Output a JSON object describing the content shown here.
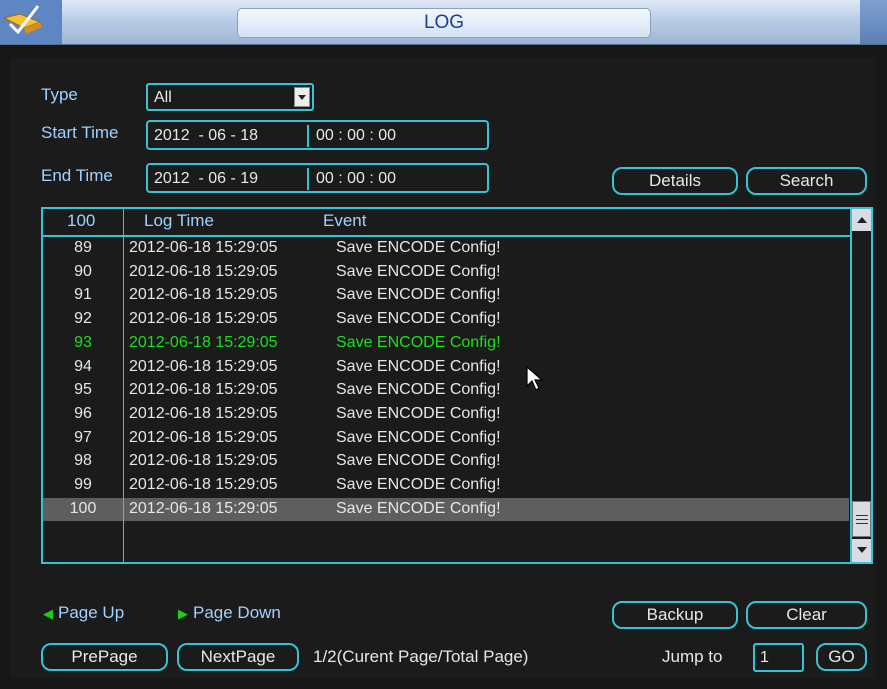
{
  "window": {
    "title": "LOG"
  },
  "filters": {
    "type_label": "Type",
    "type_value": "All",
    "start_label": "Start Time",
    "start_date": "2012  - 06 - 18",
    "start_time": "00 : 00 : 00",
    "end_label": "End Time",
    "end_date": "2012  - 06 - 19",
    "end_time": "00 : 00 : 00",
    "details_label": "Details",
    "search_label": "Search"
  },
  "table": {
    "headers": {
      "no": "100",
      "time": "Log Time",
      "event": "Event"
    },
    "rows": [
      {
        "no": "89",
        "time": "2012-06-18 15:29:05",
        "event": "Save ENCODE Config!"
      },
      {
        "no": "90",
        "time": "2012-06-18 15:29:05",
        "event": "Save ENCODE Config!"
      },
      {
        "no": "91",
        "time": "2012-06-18 15:29:05",
        "event": "Save ENCODE Config!"
      },
      {
        "no": "92",
        "time": "2012-06-18 15:29:05",
        "event": "Save ENCODE Config!"
      },
      {
        "no": "93",
        "time": "2012-06-18 15:29:05",
        "event": "Save ENCODE Config!"
      },
      {
        "no": "94",
        "time": "2012-06-18 15:29:05",
        "event": "Save ENCODE Config!"
      },
      {
        "no": "95",
        "time": "2012-06-18 15:29:05",
        "event": "Save ENCODE Config!"
      },
      {
        "no": "96",
        "time": "2012-06-18 15:29:05",
        "event": "Save ENCODE Config!"
      },
      {
        "no": "97",
        "time": "2012-06-18 15:29:05",
        "event": "Save ENCODE Config!"
      },
      {
        "no": "98",
        "time": "2012-06-18 15:29:05",
        "event": "Save ENCODE Config!"
      },
      {
        "no": "99",
        "time": "2012-06-18 15:29:05",
        "event": "Save ENCODE Config!"
      },
      {
        "no": "100",
        "time": "2012-06-18 15:29:05",
        "event": "Save ENCODE Config!"
      }
    ],
    "highlighted_row": "93",
    "selected_row": "100"
  },
  "footer": {
    "page_up_label": "Page Up",
    "page_down_label": "Page Down",
    "backup_label": "Backup",
    "clear_label": "Clear",
    "prepage_label": "PrePage",
    "nextpage_label": "NextPage",
    "page_info": "1/2(Curent Page/Total Page)",
    "jump_label": "Jump to",
    "jump_value": "1",
    "go_label": "GO"
  },
  "colors": {
    "accent": "#35c4d6",
    "label": "#9fd2ff",
    "highlight": "#19e019",
    "selected_bg": "#5e5e5e"
  },
  "icons": [
    "app-logo-icon",
    "dropdown-arrow-icon",
    "page-up-icon",
    "page-down-icon",
    "scroll-up-icon",
    "scroll-down-icon",
    "mouse-cursor-icon"
  ]
}
